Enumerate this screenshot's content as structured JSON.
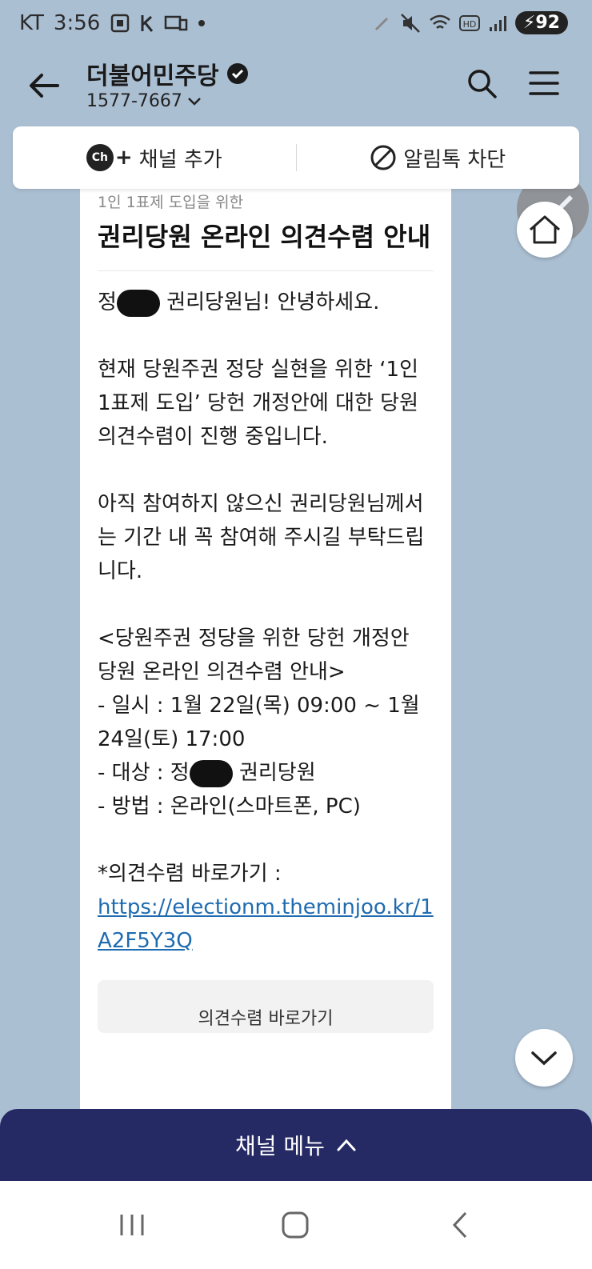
{
  "status_bar": {
    "carrier": "KT",
    "time": "3:56",
    "battery": "92"
  },
  "header": {
    "title": "더불어민주당",
    "phone": "1577-7667"
  },
  "actions": {
    "add_channel": "채널 추가",
    "block_alimtalk": "알림톡 차단",
    "ch_badge": "Ch"
  },
  "message": {
    "subtitle": "1인 1표제 도입을 위한",
    "headline": "권리당원 온라인 의견수렴 안내",
    "greeting_prefix": "정",
    "greeting_suffix": "권리당원님! 안녕하세요.",
    "paragraph1": "현재 당원주권 정당 실현을 위한 ‘1인 1표제 도입’ 당헌 개정안에 대한 당원 의견수렴이 진행 중입니다.",
    "paragraph2": "아직 참여하지 않으신 권리당원님께서는 기간 내 꼭 참여해 주시길 부탁드립니다.",
    "notice_title": "<당원주권 정당을 위한 당헌 개정안 당원 온라인 의견수렴 안내>",
    "schedule": "- 일시 : 1월 22일(목) 09:00 ~ 1월 24일(토) 17:00",
    "target_prefix": "- 대상 : 정",
    "target_suffix": "권리당원",
    "method": "- 방법 : 온라인(스마트폰, PC)",
    "link_label": "*의견수렴 바로가기 :",
    "link_url": "https://electionm.theminjoo.kr/1A2F5Y3Q",
    "button_label": "의견수렴 바로가기"
  },
  "channel_menu": {
    "label": "채널 메뉴"
  }
}
